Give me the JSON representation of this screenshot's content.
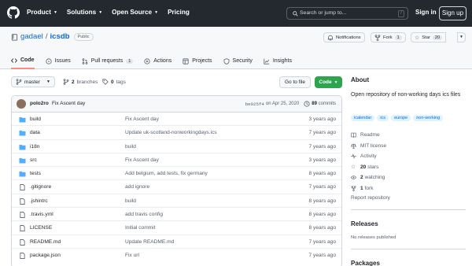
{
  "topbar": {
    "nav": [
      "Product",
      "Solutions",
      "Open Source",
      "Pricing"
    ],
    "search_placeholder": "Search or jump to...",
    "search_shortcut": "/",
    "signin": "Sign in",
    "signup": "Sign up"
  },
  "repo": {
    "owner": "gadael",
    "separator": "/",
    "name": "icsdb",
    "visibility": "Public",
    "notifications": "Notifications",
    "fork_label": "Fork",
    "fork_count": "1",
    "star_label": "Star",
    "star_count": "20"
  },
  "tabs": [
    {
      "label": "Code",
      "icon": "code-icon",
      "active": true
    },
    {
      "label": "Issues",
      "icon": "issue-icon"
    },
    {
      "label": "Pull requests",
      "icon": "pull-request-icon",
      "count": "1"
    },
    {
      "label": "Actions",
      "icon": "play-icon"
    },
    {
      "label": "Projects",
      "icon": "table-icon"
    },
    {
      "label": "Security",
      "icon": "shield-icon"
    },
    {
      "label": "Insights",
      "icon": "graph-icon"
    }
  ],
  "branch": {
    "name": "master",
    "branches_count": "2",
    "branches_label": "branches",
    "tags_count": "0",
    "tags_label": "tags",
    "goto_file": "Go to file",
    "code_button": "Code"
  },
  "commit": {
    "author": "polo2ro",
    "message": "Fix Ascent day",
    "hash": "be025f4",
    "date": "on Apr 25, 2020",
    "count": "89",
    "count_label": "commits"
  },
  "files": [
    {
      "name": "build",
      "type": "dir",
      "message": "Fix Ascent day",
      "age": "3 years ago"
    },
    {
      "name": "data",
      "type": "dir",
      "message": "Update uk-scotland-nonworkingdays.ics",
      "age": "7 years ago"
    },
    {
      "name": "i18n",
      "type": "dir",
      "message": "build",
      "age": "7 years ago"
    },
    {
      "name": "src",
      "type": "dir",
      "message": "Fix Ascent day",
      "age": "3 years ago"
    },
    {
      "name": "tests",
      "type": "dir",
      "message": "Add belgium, add tests, fix germany",
      "age": "8 years ago"
    },
    {
      "name": ".gitignore",
      "type": "file",
      "message": "add ignore",
      "age": "7 years ago"
    },
    {
      "name": ".jshintrc",
      "type": "file",
      "message": "build",
      "age": "8 years ago"
    },
    {
      "name": ".travis.yml",
      "type": "file",
      "message": "add travis config",
      "age": "8 years ago"
    },
    {
      "name": "LICENSE",
      "type": "file",
      "message": "Initial commit",
      "age": "8 years ago"
    },
    {
      "name": "README.md",
      "type": "file",
      "message": "Update README.md",
      "age": "7 years ago"
    },
    {
      "name": "package.json",
      "type": "file",
      "message": "Fix url",
      "age": "7 years ago"
    }
  ],
  "about": {
    "heading": "About",
    "description": "Open repository of non-working days ics files",
    "topics": [
      "icalendar",
      "ics",
      "europe",
      "non-working"
    ],
    "readme": "Readme",
    "license": "MIT license",
    "activity": "Activity",
    "stars_count": "20",
    "stars_label": "stars",
    "watching_count": "2",
    "watching_label": "watching",
    "forks_count": "1",
    "forks_label": "fork",
    "report": "Report repository"
  },
  "releases": {
    "heading": "Releases",
    "none": "No releases published"
  },
  "packages": {
    "heading": "Packages"
  }
}
